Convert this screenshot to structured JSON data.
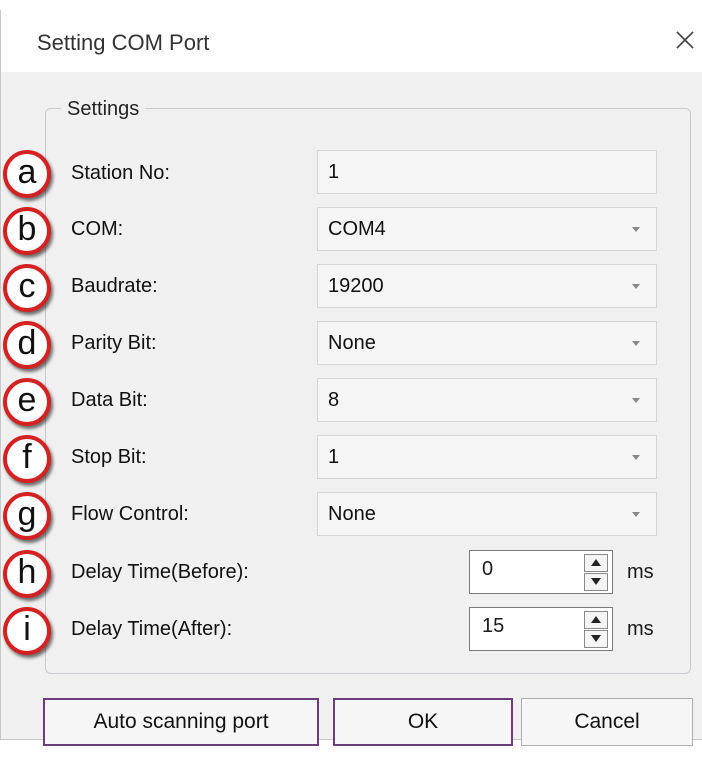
{
  "window": {
    "title": "Setting COM Port",
    "close_icon": "close-icon"
  },
  "group": {
    "label": "Settings"
  },
  "rows": [
    {
      "marker": "a",
      "label": "Station No:",
      "value": "1",
      "kind": "text"
    },
    {
      "marker": "b",
      "label": "COM:",
      "value": "COM4",
      "kind": "dropdown"
    },
    {
      "marker": "c",
      "label": "Baudrate:",
      "value": "19200",
      "kind": "dropdown"
    },
    {
      "marker": "d",
      "label": "Parity Bit:",
      "value": "None",
      "kind": "dropdown"
    },
    {
      "marker": "e",
      "label": "Data Bit:",
      "value": "8",
      "kind": "dropdown"
    },
    {
      "marker": "f",
      "label": "Stop Bit:",
      "value": "1",
      "kind": "dropdown"
    },
    {
      "marker": "g",
      "label": "Flow Control:",
      "value": "None",
      "kind": "dropdown"
    },
    {
      "marker": "h",
      "label": "Delay Time(Before):",
      "value": "0",
      "unit": "ms",
      "kind": "spin"
    },
    {
      "marker": "i",
      "label": "Delay Time(After):",
      "value": "15",
      "unit": "ms",
      "kind": "spin"
    }
  ],
  "buttons": {
    "auto_scan": "Auto scanning port",
    "ok": "OK",
    "cancel": "Cancel"
  },
  "colors": {
    "marker_ring": "#d42121",
    "primary_border": "#6b3d7a",
    "dialog_bg": "#f0f0f0"
  }
}
